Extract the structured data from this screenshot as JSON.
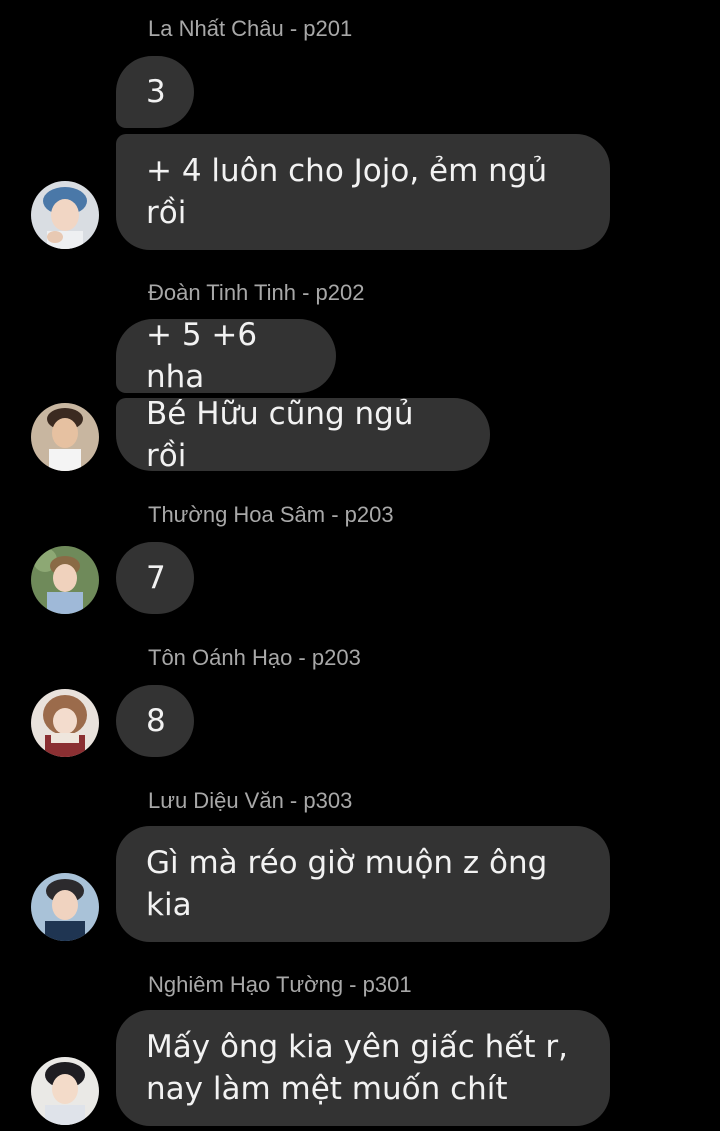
{
  "messages": [
    {
      "sender": "La Nhất Châu - p201",
      "bubbles": [
        "3",
        "+ 4 luôn cho Jojo, ẻm ngủ\nrồi"
      ],
      "avatar": "avatar-icon"
    },
    {
      "sender": "Đoàn Tinh Tinh - p202",
      "bubbles": [
        "+ 5 +6 nha",
        "Bé Hữu cũng ngủ rồi"
      ],
      "avatar": "avatar-icon"
    },
    {
      "sender": "Thường Hoa Sâm - p203",
      "bubbles": [
        "7"
      ],
      "avatar": "avatar-icon"
    },
    {
      "sender": "Tôn Oánh Hạo - p203",
      "bubbles": [
        "8"
      ],
      "avatar": "avatar-icon"
    },
    {
      "sender": "Lưu Diệu Văn - p303",
      "bubbles": [
        "Gì mà réo giờ muộn z ông\nkia"
      ],
      "avatar": "avatar-icon"
    },
    {
      "sender": "Nghiêm Hạo Tường - p301",
      "bubbles": [
        "Mấy ông kia yên giấc hết r,\nnay làm mệt muốn chít"
      ],
      "avatar": "avatar-icon"
    }
  ],
  "colors": {
    "background": "#000000",
    "bubble": "#333333",
    "bubble_text": "#f2f2f2",
    "sender_text": "#a8a8a8"
  }
}
